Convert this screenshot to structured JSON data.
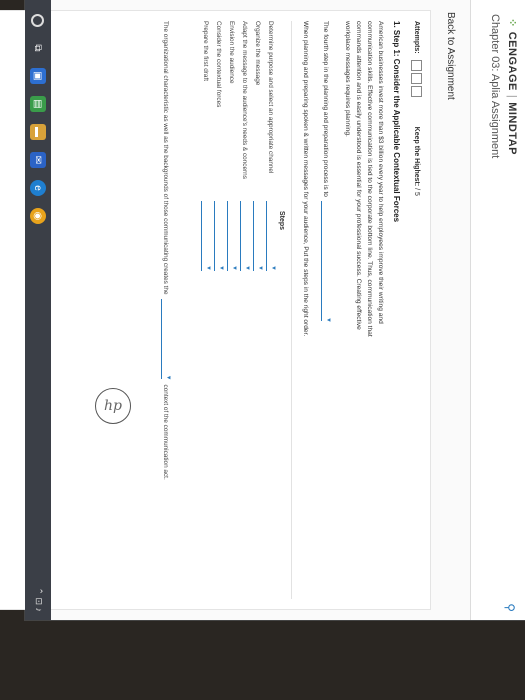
{
  "header": {
    "brand": "CENGAGE",
    "product": "MINDTAP",
    "chapter": "Chapter 03: Aplia Assignment"
  },
  "nav": {
    "back": "Back to Assignment"
  },
  "attempts": {
    "label": "Attempts:",
    "keep_label": "Keep the Highest:",
    "keep_value": "/ 5"
  },
  "step_title": "1. Step 1: Consider the Applicable Contextual Forces",
  "paragraph": "American businesses invest more than $3 billion every year to help employees improve their writing and communication skills. Effective communication is tied to the corporate bottom line. Thus, communication that commands attention and is easily understood is essential for your professional success. Creating effective workplace messages requires planning.",
  "fourth_step": "The fourth step in the planning and preparation process is to",
  "instruction": "When planning and preparing spoken & written messages for your audience, Put the steps in the right order.",
  "steps_header": "Steps",
  "steps": [
    "Determine purpose and select an appropriate channel",
    "Organize the message",
    "Adapt the message to the audience's needs & concerns",
    "Envision the audience",
    "Consider the contextual forces",
    "Prepare the first draft"
  ],
  "final_sentence_a": "The organizational characteristic as well as the backgrounds of those communicating creates the",
  "final_sentence_b": "context of the communication act.",
  "brand_mark": "hp",
  "colors": {
    "accent": "#2a7bbf",
    "taskbar": "#3b3f47"
  }
}
